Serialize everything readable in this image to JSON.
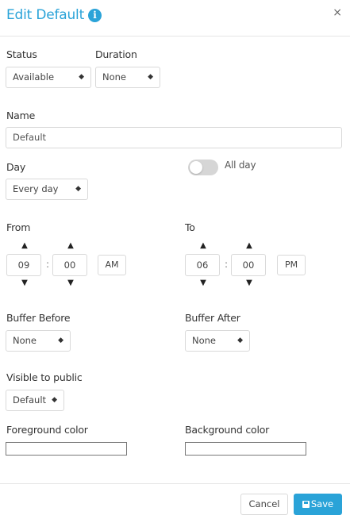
{
  "header": {
    "title": "Edit Default",
    "info_icon": "i",
    "close_icon": "×"
  },
  "status": {
    "label": "Status",
    "value": "Available"
  },
  "duration": {
    "label": "Duration",
    "value": "None"
  },
  "name": {
    "label": "Name",
    "value": "Default"
  },
  "day": {
    "label": "Day",
    "value": "Every day",
    "all_day_label": "All day",
    "all_day_enabled": false
  },
  "from": {
    "label": "From",
    "hour": "09",
    "minute": "00",
    "period": "AM"
  },
  "to": {
    "label": "To",
    "hour": "06",
    "minute": "00",
    "period": "PM"
  },
  "time_separator": ":",
  "buffer_before": {
    "label": "Buffer Before",
    "value": "None"
  },
  "buffer_after": {
    "label": "Buffer After",
    "value": "None"
  },
  "visibility": {
    "label": "Visible to public",
    "value": "Default"
  },
  "foreground_color": {
    "label": "Foreground color",
    "value": ""
  },
  "background_color": {
    "label": "Background color",
    "value": ""
  },
  "footer": {
    "cancel_label": "Cancel",
    "save_label": "Save"
  },
  "icons": {
    "chevron_up": "▲",
    "chevron_down": "▼",
    "select_arrows": "⬍"
  },
  "colors": {
    "accent": "#2aa3d8",
    "toggle_off": "#d6d6d6"
  }
}
